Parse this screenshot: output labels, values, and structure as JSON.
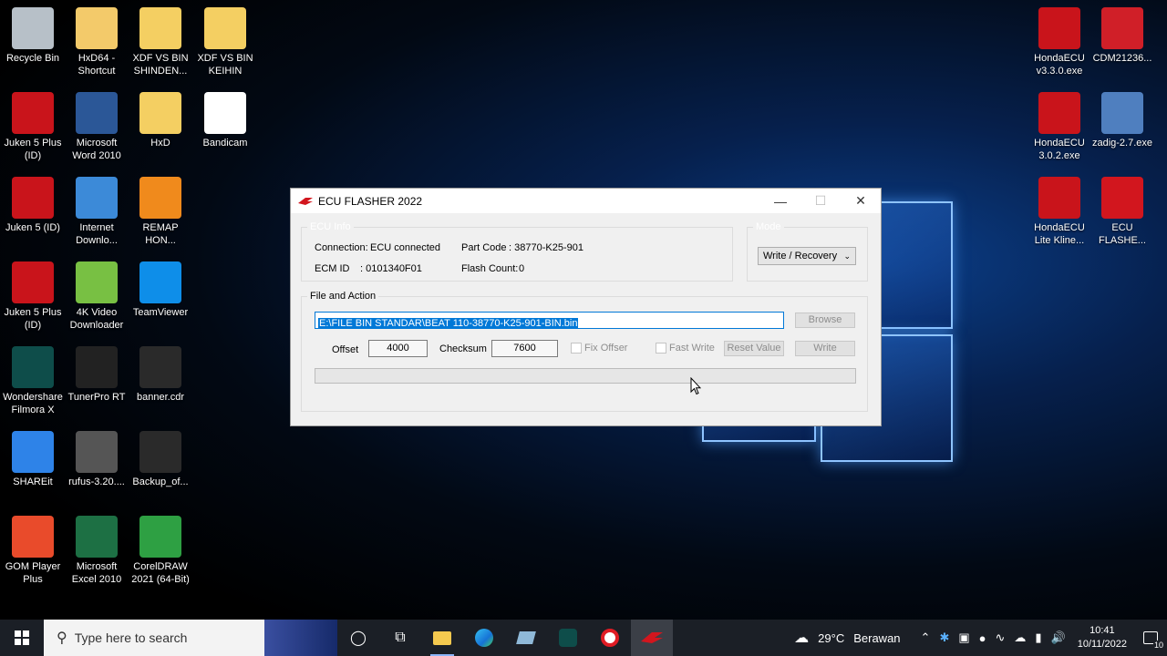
{
  "desktop_icons": [
    {
      "label": "Recycle Bin",
      "icon": "recycle-bin-icon",
      "color": "#b7c0c8"
    },
    {
      "label": "HxD64 - Shortcut",
      "icon": "hxd-icon",
      "color": "#f3ca6a"
    },
    {
      "label": "XDF VS BIN SHINDEN...",
      "icon": "folder-icon",
      "color": "#f4cf62"
    },
    {
      "label": "XDF VS BIN KEIHIN",
      "icon": "folder-icon",
      "color": "#f4cf62"
    },
    {
      "label": "Juken 5 Plus (ID)",
      "icon": "brt-icon",
      "color": "#c9141b"
    },
    {
      "label": "Microsoft Word 2010",
      "icon": "word-icon",
      "color": "#2b5797"
    },
    {
      "label": "HxD",
      "icon": "folder-icon",
      "color": "#f4cf62"
    },
    {
      "label": "Bandicam",
      "icon": "bandicam-icon",
      "color": "#ffffff"
    },
    {
      "label": "Juken 5 (ID)",
      "icon": "brt-icon",
      "color": "#c9141b"
    },
    {
      "label": "Internet Downlo...",
      "icon": "idm-icon",
      "color": "#3c8ad8"
    },
    {
      "label": "REMAP HON...",
      "icon": "remap-icon",
      "color": "#f08a1c"
    },
    {
      "label": "Juken 5 Plus (ID)",
      "icon": "brt-icon",
      "color": "#c9141b"
    },
    {
      "label": "4K Video Downloader",
      "icon": "4k-video-icon",
      "color": "#78c043"
    },
    {
      "label": "TeamViewer",
      "icon": "teamviewer-icon",
      "color": "#0e8ee9"
    },
    {
      "label": "Wondershare Filmora X",
      "icon": "filmora-icon",
      "color": "#0e4d4a"
    },
    {
      "label": "TunerPro RT",
      "icon": "chip-icon",
      "color": "#222222"
    },
    {
      "label": "banner.cdr",
      "icon": "cdr-file-icon",
      "color": "#2a2a2a"
    },
    {
      "label": "SHAREit",
      "icon": "shareit-icon",
      "color": "#2e83e8"
    },
    {
      "label": "rufus-3.20....",
      "icon": "usb-icon",
      "color": "#555555"
    },
    {
      "label": "Backup_of...",
      "icon": "cdr-file-icon",
      "color": "#2a2a2a"
    },
    {
      "label": "GOM Player Plus",
      "icon": "gom-icon",
      "color": "#e94b2b"
    },
    {
      "label": "Microsoft Excel 2010",
      "icon": "excel-icon",
      "color": "#1d7044"
    },
    {
      "label": "CorelDRAW 2021 (64-Bit)",
      "icon": "coreldraw-icon",
      "color": "#2ea043"
    },
    {
      "label": "HondaECU v3.3.0.exe",
      "icon": "honda-icon",
      "color": "#c9141b"
    },
    {
      "label": "CDM21236...",
      "icon": "cdm-icon",
      "color": "#d01f28"
    },
    {
      "label": "HondaECU 3.0.2.exe",
      "icon": "honda-icon",
      "color": "#c9141b"
    },
    {
      "label": "zadig-2.7.exe",
      "icon": "zadig-icon",
      "color": "#4f7fbf"
    },
    {
      "label": "HondaECU Lite Kline...",
      "icon": "honda-icon",
      "color": "#c9141b"
    },
    {
      "label": "ECU FLASHE...",
      "icon": "honda-wing-icon",
      "color": "#d2161e"
    }
  ],
  "window": {
    "title": "ECU FLASHER 2022",
    "ecu_info": {
      "legend": "ECU Info",
      "connection_label": "Connection:",
      "connection_value": "ECU connected",
      "part_code_label": "Part Code",
      "part_code_value": ":   38770-K25-901",
      "ecm_id_label": "ECM ID",
      "ecm_id_value": ":   0101340F01",
      "flash_count_label": "Flash Count:",
      "flash_count_value": "0"
    },
    "mode": {
      "legend": "Mode",
      "selected": "Write / Recovery"
    },
    "file_action": {
      "legend": "File and Action",
      "path": "E:\\FILE BIN STANDAR\\BEAT 110-38770-K25-901-BIN.bin",
      "browse_label": "Browse",
      "offset_label": "Offset",
      "offset_value": "4000",
      "checksum_label": "Checksum",
      "checksum_value": "7600",
      "fix_offset_label": "Fix Offser",
      "fast_write_label": "Fast Write",
      "reset_value_label": "Reset Value",
      "write_label": "Write",
      "progress": 0
    }
  },
  "taskbar": {
    "search_placeholder": "Type here to search",
    "weather_temp": "29°C",
    "weather_text": "Berawan",
    "time": "10:41",
    "date": "10/11/2022",
    "notification_count": "10"
  }
}
